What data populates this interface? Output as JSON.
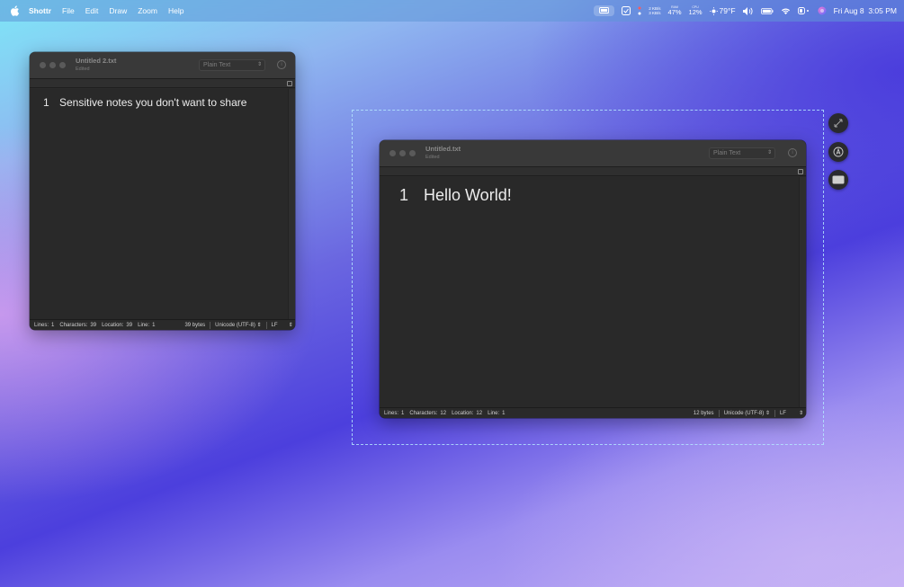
{
  "menubar": {
    "app_name": "Shottr",
    "menus": [
      "File",
      "Edit",
      "Draw",
      "Zoom",
      "Help"
    ],
    "network": {
      "up": "2 KB/s",
      "down": "3 KB/s"
    },
    "ram": {
      "label": "RAM",
      "value": "47%"
    },
    "cpu": {
      "label": "CPU",
      "value": "12%"
    },
    "weather": "79°F",
    "datetime": "Fri Aug 8  3:05 PM"
  },
  "window_back": {
    "title": "Untitled 2.txt",
    "subtitle": "Edited",
    "format": "Plain Text",
    "line_number": "1",
    "text": "Sensitive notes you don't want to share",
    "status": {
      "lines_label": "Lines:",
      "lines": "1",
      "chars_label": "Characters:",
      "chars": "39",
      "loc_label": "Location:",
      "loc": "39",
      "line_label": "Line:",
      "line": "1",
      "bytes": "39 bytes",
      "encoding": "Unicode (UTF-8)",
      "line_ending": "LF"
    }
  },
  "window_front": {
    "title": "Untitled.txt",
    "subtitle": "Edited",
    "format": "Plain Text",
    "line_number": "1",
    "text": "Hello World!",
    "status": {
      "lines_label": "Lines:",
      "lines": "1",
      "chars_label": "Characters:",
      "chars": "12",
      "loc_label": "Location:",
      "loc": "12",
      "line_label": "Line:",
      "line": "1",
      "bytes": "12 bytes",
      "encoding": "Unicode (UTF-8)",
      "line_ending": "LF"
    }
  },
  "capture_tools": [
    "expand-icon",
    "markup-pen-icon",
    "window-capture-icon"
  ]
}
